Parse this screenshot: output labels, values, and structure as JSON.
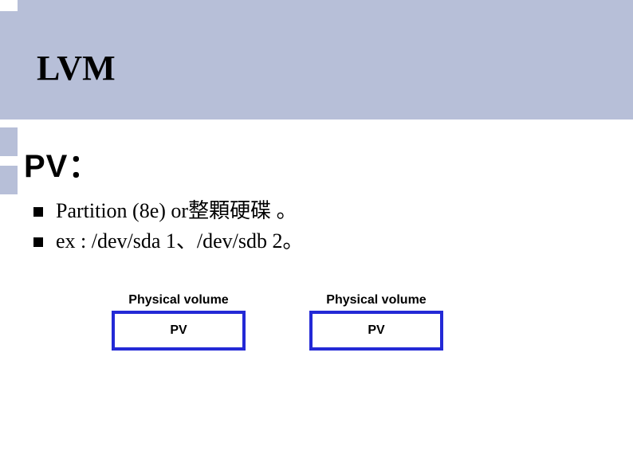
{
  "slide_title": "LVM",
  "section_heading": "PV：",
  "bullets": {
    "items": [
      "Partition (8e) or整顆硬碟 。",
      "ex : /dev/sda 1、/dev/sdb 2。"
    ]
  },
  "pv_diagram": {
    "blocks": [
      {
        "label": "Physical volume",
        "box_text": "PV"
      },
      {
        "label": "Physical volume",
        "box_text": "PV"
      }
    ]
  }
}
